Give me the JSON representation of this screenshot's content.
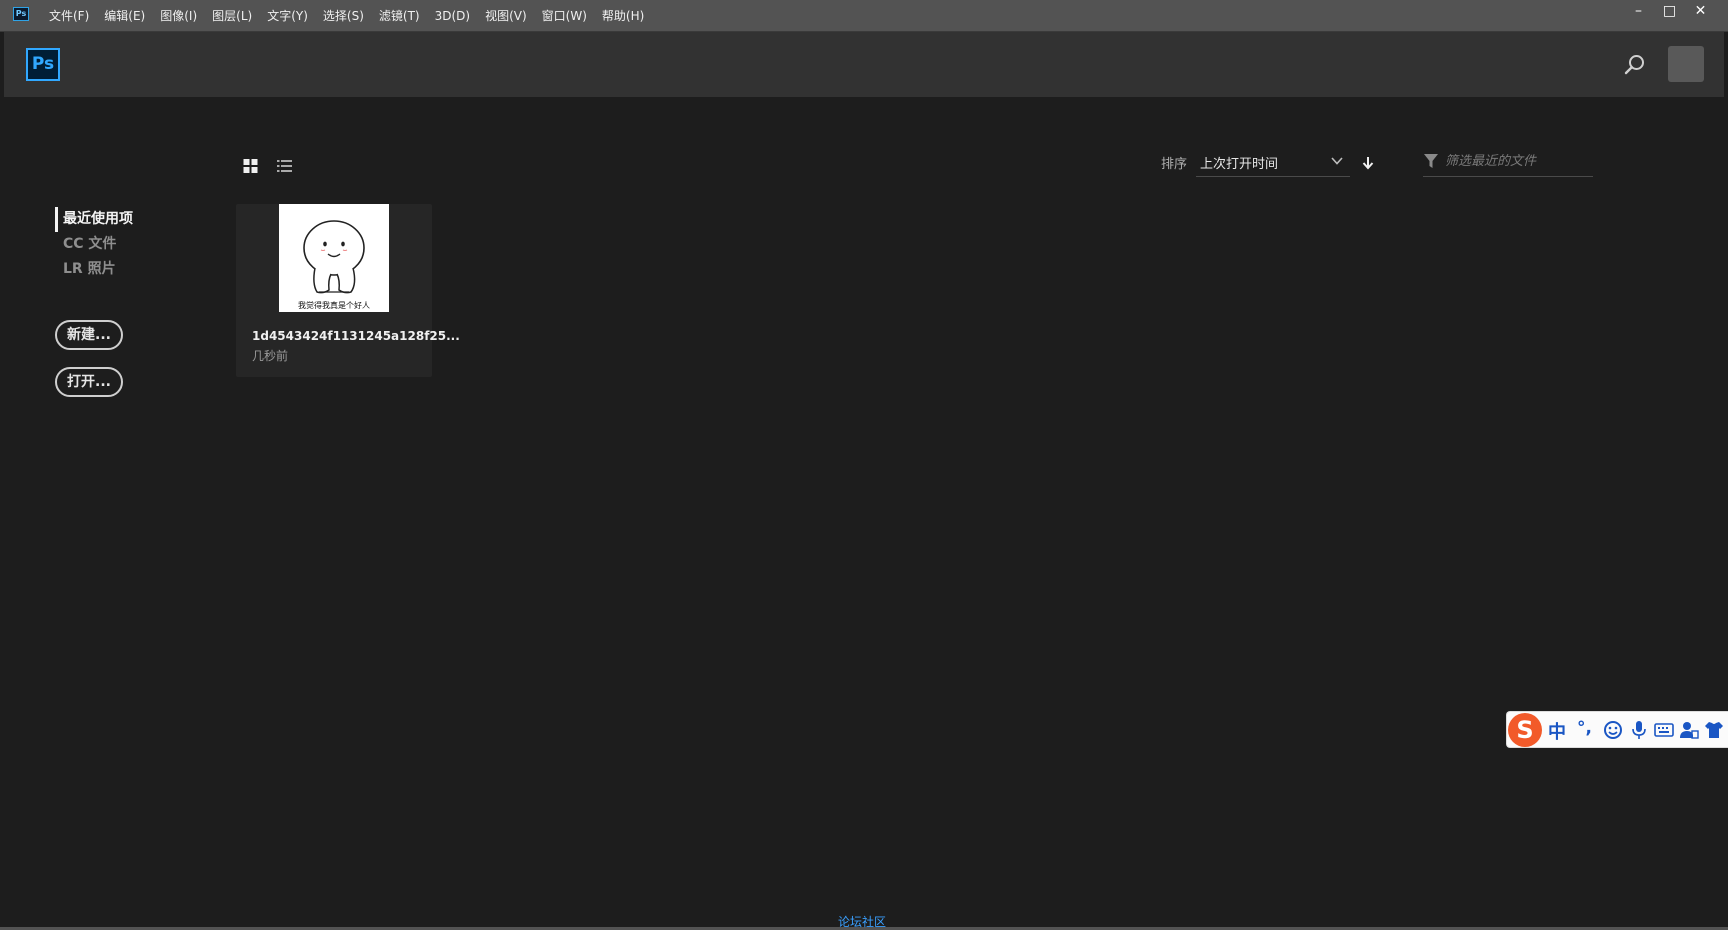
{
  "app": {
    "icon_text": "Ps"
  },
  "menu": [
    "文件(F)",
    "编辑(E)",
    "图像(I)",
    "图层(L)",
    "文字(Y)",
    "选择(S)",
    "滤镜(T)",
    "3D(D)",
    "视图(V)",
    "窗口(W)",
    "帮助(H)"
  ],
  "window_controls": {
    "minimize": "–",
    "maximize": "□",
    "close": "✕"
  },
  "header": {
    "logo_text": "Ps",
    "search_icon": "search-icon",
    "avatar_icon": "user-avatar"
  },
  "sidebar": {
    "items": [
      {
        "label": "最近使用项",
        "active": true
      },
      {
        "label": "CC 文件",
        "active": false
      },
      {
        "label": "LR 照片",
        "active": false
      }
    ],
    "new_button": "新建...",
    "open_button": "打开..."
  },
  "toolbar": {
    "grid_view_icon": "grid-view-icon",
    "list_view_icon": "list-view-icon",
    "sort_label": "排序",
    "sort_value": "上次打开时间",
    "sort_direction_icon": "arrow-down-icon",
    "filter_icon": "filter-icon",
    "filter_placeholder": "筛选最近的文件",
    "filter_value": ""
  },
  "recent_files": [
    {
      "name": "1d4543424f1131245a128f25...",
      "time": "几秒前",
      "thumbnail_caption": "我觉得我真是个好人"
    }
  ],
  "footer": {
    "link": "论坛社区"
  },
  "ime_toolbar": {
    "logo": "S",
    "mode": "中",
    "punct": "°,"
  },
  "colors": {
    "background": "#1d1d1d",
    "header": "#323232",
    "menubar": "#535353",
    "ps_blue": "#31a8ff",
    "link": "#3aa0ff",
    "ime_orange": "#f25a2a",
    "ime_blue": "#1a56c4"
  }
}
